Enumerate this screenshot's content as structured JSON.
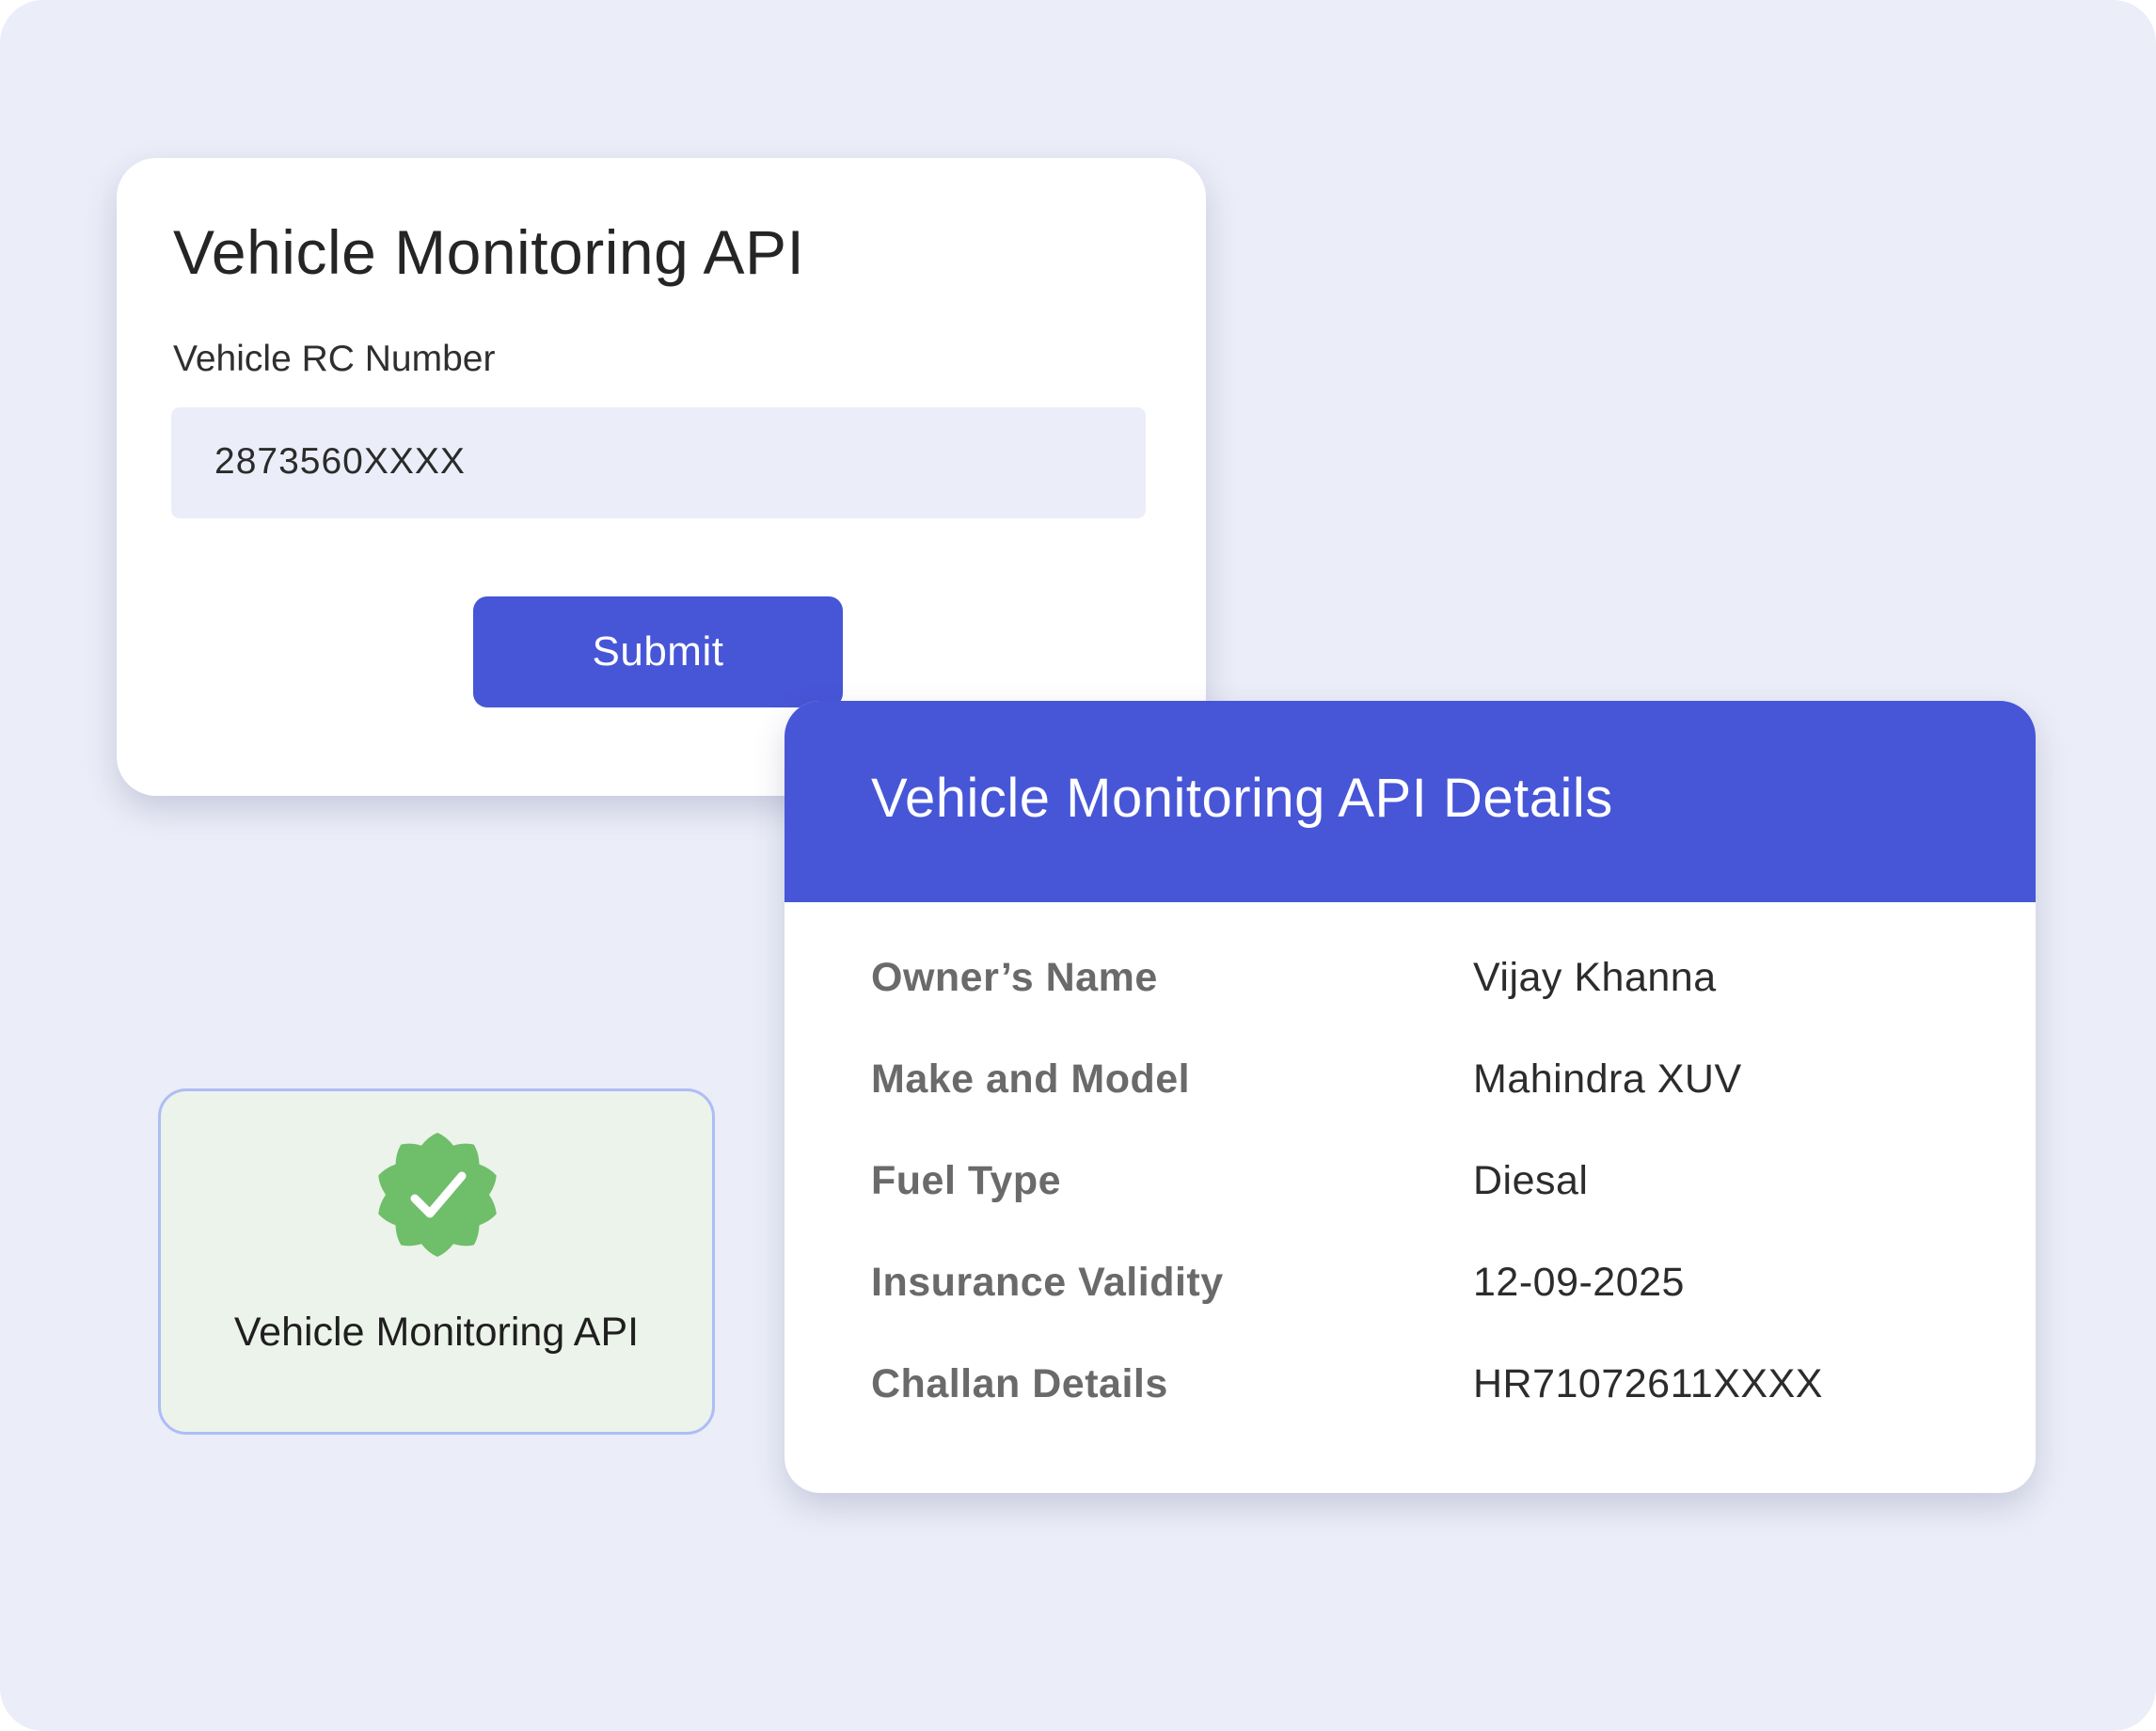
{
  "form": {
    "title": "Vehicle Monitoring API",
    "field_label": "Vehicle RC Number",
    "field_value": "2873560XXXX",
    "submit_label": "Submit"
  },
  "badge": {
    "icon": "verified-check-icon",
    "label": "Vehicle Monitoring API",
    "icon_color": "#6fbe6a"
  },
  "details": {
    "title": "Vehicle Monitoring API Details",
    "rows": [
      {
        "label": "Owner’s Name",
        "value": "Vijay Khanna"
      },
      {
        "label": "Make and Model",
        "value": "Mahindra XUV"
      },
      {
        "label": "Fuel Type",
        "value": "Diesal"
      },
      {
        "label": "Insurance Validity",
        "value": "12-09-2025"
      },
      {
        "label": "Challan Details",
        "value": "HR71072611XXXX"
      }
    ]
  },
  "colors": {
    "background": "#ebedf8",
    "accent": "#4756d7",
    "badge_background": "#ecf3ea",
    "badge_border": "#aebdf5"
  }
}
